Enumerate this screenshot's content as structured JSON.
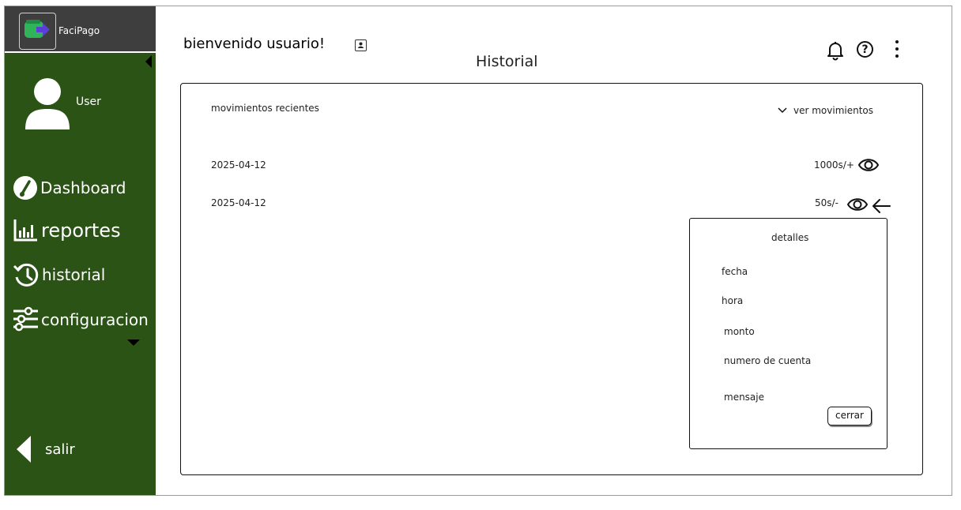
{
  "app": {
    "name": "FaciPago"
  },
  "sidebar": {
    "user_label": "User",
    "items": [
      {
        "label": "Dashboard",
        "icon": "speedometer-icon"
      },
      {
        "label": "reportes",
        "icon": "bar-chart-icon"
      },
      {
        "label": "historial",
        "icon": "history-icon"
      },
      {
        "label": "configuracion",
        "icon": "sliders-icon"
      }
    ],
    "logout_label": "salir"
  },
  "header": {
    "welcome": "bienvenido usuario!",
    "page_title": "Historial"
  },
  "movements": {
    "title": "movimientos recientes",
    "toggle_label": "ver movimientos",
    "rows": [
      {
        "date": "2025-04-12",
        "amount": "1000s/+"
      },
      {
        "date": "2025-04-12",
        "amount": "50s/-"
      }
    ]
  },
  "details": {
    "title": "detalles",
    "fields": [
      "fecha",
      "hora",
      "monto",
      "numero de cuenta",
      "mensaje"
    ],
    "close_label": "cerrar"
  },
  "colors": {
    "sidebar_bg": "#2a5315",
    "logo_bar_bg": "#3e3e3e"
  }
}
